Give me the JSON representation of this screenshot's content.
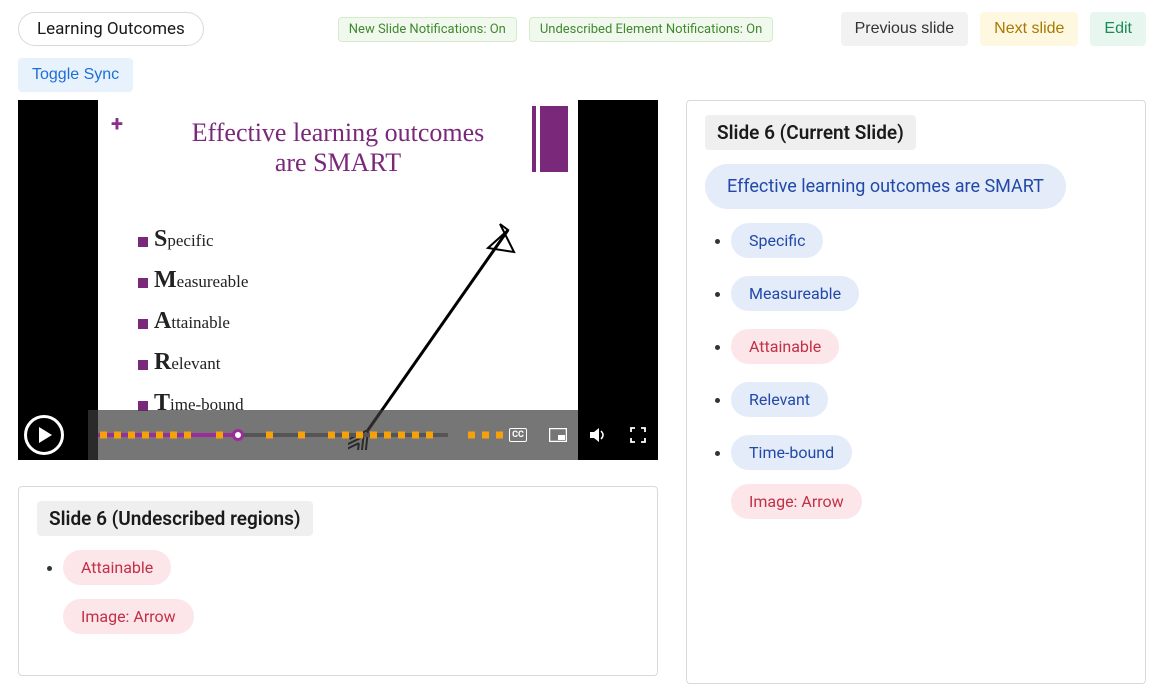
{
  "header": {
    "title": "Learning Outcomes",
    "new_slide_notif": "New Slide Notifications: On",
    "undescribed_notif": "Undescribed Element Notifications: On",
    "prev_slide": "Previous slide",
    "next_slide": "Next slide",
    "edit": "Edit",
    "toggle_sync": "Toggle Sync"
  },
  "slide": {
    "title_line1": "Effective learning outcomes",
    "title_line2": "are SMART",
    "items": {
      "s_first": "S",
      "s_rest": "pecific",
      "m_first": "M",
      "m_rest": "easureable",
      "a_first": "A",
      "a_rest": "ttainable",
      "r_first": "R",
      "r_rest": "elevant",
      "t_first": "T",
      "t_rest": "ime-bound"
    },
    "cc_label": "CC"
  },
  "undescribed_panel": {
    "header": "Slide 6 (Undescribed regions)",
    "item1": "Attainable",
    "item2": "Image: Arrow"
  },
  "current_panel": {
    "header": "Slide 6 (Current Slide)",
    "title_chip": "Effective learning outcomes are SMART",
    "b1": "Specific",
    "b2": "Measureable",
    "b3": "Attainable",
    "b4": "Relevant",
    "b5": "Time-bound",
    "img": "Image: Arrow"
  },
  "colors": {
    "purple": "#7a287a",
    "tick": "#f5a20a"
  }
}
